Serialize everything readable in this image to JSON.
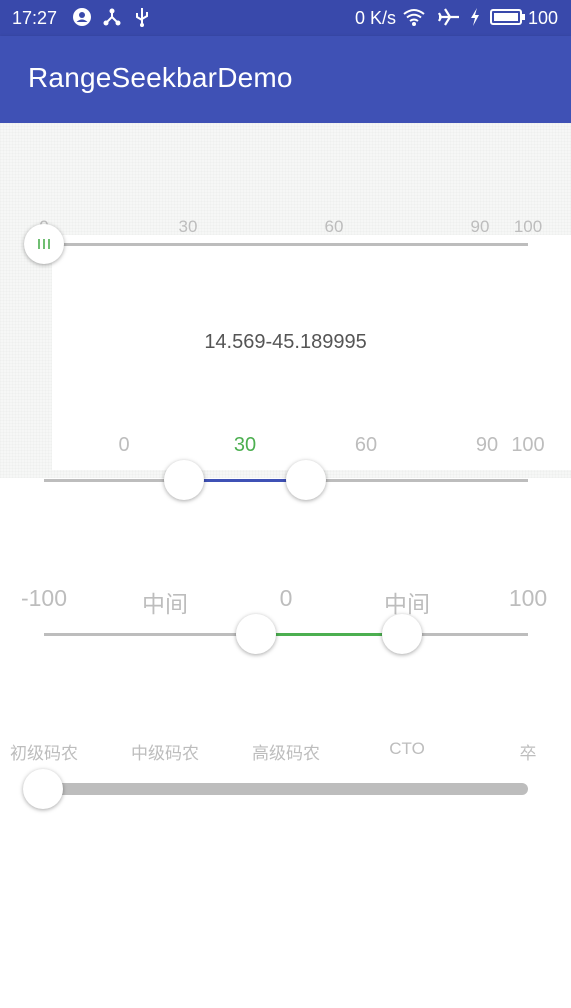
{
  "status_bar": {
    "time": "17:27",
    "net_speed": "0 K/s",
    "battery": "100"
  },
  "app_bar": {
    "title": "RangeSeekbarDemo"
  },
  "seekbar1": {
    "ticks": [
      "0",
      "30",
      "60",
      "90",
      "100"
    ],
    "value": 0,
    "thumb_icon": "grip-lines-icon",
    "accent": "#4caf50"
  },
  "range_text": "14.569-45.189995",
  "seekbar2": {
    "ticks": [
      "0",
      "30",
      "60",
      "90",
      "100"
    ],
    "highlight_tick_color": "#4caf50",
    "range": [
      14.569,
      45.189995
    ],
    "progress_color": "#3f51b5"
  },
  "seekbar3": {
    "ticks": [
      "-100",
      "中间",
      "0",
      "中间",
      "100"
    ],
    "progress_color": "#4caf50"
  },
  "seekbar4": {
    "ticks": [
      "初级码农",
      "中级码农",
      "高级码农",
      "CTO",
      "卒"
    ],
    "value": 0
  }
}
